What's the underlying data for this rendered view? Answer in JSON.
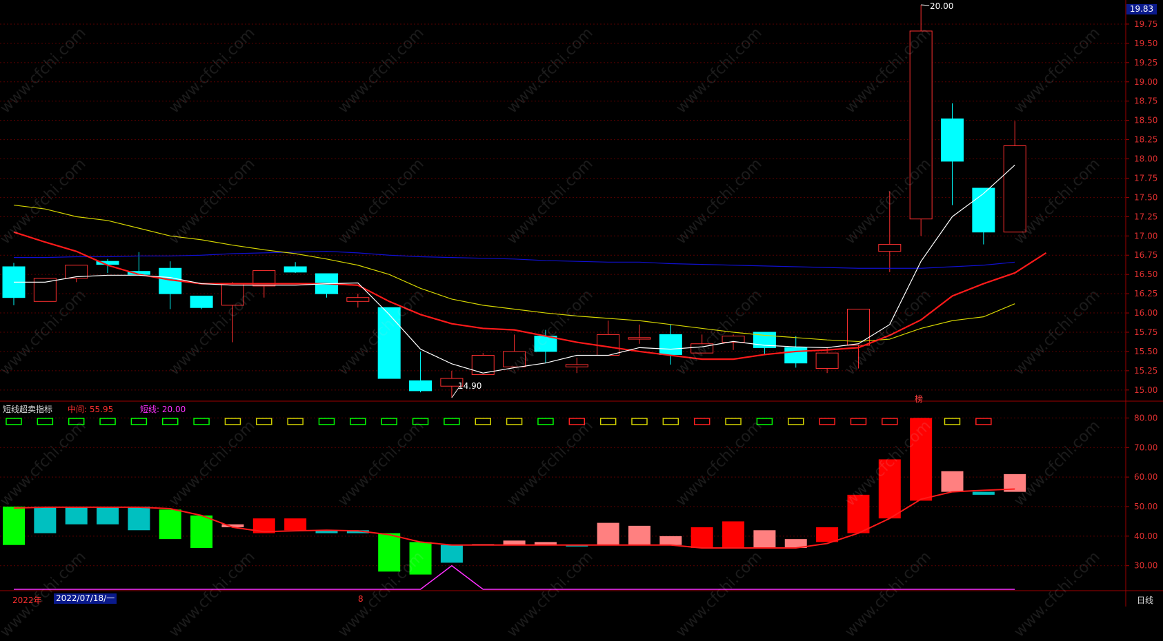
{
  "indicator": {
    "title": "短线超卖指标",
    "mid_label": "中间: 55.95",
    "short_label": "短线: 20.00"
  },
  "price_badge": "19.83",
  "annotations": {
    "high": "20.00",
    "low": "14.90",
    "flag": "榜"
  },
  "footer": {
    "year": "2022年",
    "date": "2022/07/18/一",
    "month": "8",
    "period": "日线"
  },
  "watermark": "www.cfchi.com",
  "colors": {
    "up": "#ff3030",
    "down": "#00ffff",
    "ma5": "#ffffff",
    "ma10": "#ff1a1a",
    "ma20": "#d4d400",
    "ma60": "#1010d0",
    "grid": "#5a0000"
  },
  "chart_data": [
    {
      "type": "candlestick",
      "y_ticks": [
        15.0,
        15.25,
        15.5,
        15.75,
        16.0,
        16.25,
        16.5,
        16.75,
        17.0,
        17.25,
        17.5,
        17.75,
        18.0,
        18.25,
        18.5,
        18.75,
        19.0,
        19.25,
        19.5,
        19.75
      ],
      "ylim": [
        14.9,
        20.0
      ],
      "candles": [
        {
          "o": 16.6,
          "h": 16.65,
          "l": 16.1,
          "c": 16.2
        },
        {
          "o": 16.15,
          "h": 16.45,
          "l": 16.15,
          "c": 16.45
        },
        {
          "o": 16.45,
          "h": 16.62,
          "l": 16.4,
          "c": 16.62
        },
        {
          "o": 16.67,
          "h": 16.7,
          "l": 16.52,
          "c": 16.63
        },
        {
          "o": 16.54,
          "h": 16.79,
          "l": 16.5,
          "c": 16.5
        },
        {
          "o": 16.58,
          "h": 16.67,
          "l": 16.05,
          "c": 16.25
        },
        {
          "o": 16.22,
          "h": 16.22,
          "l": 16.05,
          "c": 16.07
        },
        {
          "o": 16.1,
          "h": 16.4,
          "l": 15.62,
          "c": 16.38
        },
        {
          "o": 16.35,
          "h": 16.55,
          "l": 16.2,
          "c": 16.55
        },
        {
          "o": 16.6,
          "h": 16.66,
          "l": 16.52,
          "c": 16.53
        },
        {
          "o": 16.51,
          "h": 16.51,
          "l": 16.2,
          "c": 16.25
        },
        {
          "o": 16.15,
          "h": 16.25,
          "l": 16.07,
          "c": 16.2
        },
        {
          "o": 16.07,
          "h": 16.07,
          "l": 15.15,
          "c": 15.15
        },
        {
          "o": 15.12,
          "h": 15.5,
          "l": 14.97,
          "c": 14.99
        },
        {
          "o": 15.05,
          "h": 15.25,
          "l": 14.9,
          "c": 15.15
        },
        {
          "o": 15.2,
          "h": 15.48,
          "l": 15.2,
          "c": 15.45
        },
        {
          "o": 15.3,
          "h": 15.72,
          "l": 15.3,
          "c": 15.5
        },
        {
          "o": 15.7,
          "h": 15.78,
          "l": 15.35,
          "c": 15.5
        },
        {
          "o": 15.3,
          "h": 15.42,
          "l": 15.22,
          "c": 15.33
        },
        {
          "o": 15.45,
          "h": 15.9,
          "l": 15.45,
          "c": 15.72
        },
        {
          "o": 15.66,
          "h": 15.85,
          "l": 15.6,
          "c": 15.68
        },
        {
          "o": 15.72,
          "h": 15.85,
          "l": 15.33,
          "c": 15.46
        },
        {
          "o": 15.48,
          "h": 15.72,
          "l": 15.48,
          "c": 15.6
        },
        {
          "o": 15.62,
          "h": 15.72,
          "l": 15.52,
          "c": 15.7
        },
        {
          "o": 15.75,
          "h": 15.75,
          "l": 15.45,
          "c": 15.55
        },
        {
          "o": 15.55,
          "h": 15.7,
          "l": 15.29,
          "c": 15.35
        },
        {
          "o": 15.28,
          "h": 15.55,
          "l": 15.22,
          "c": 15.48
        },
        {
          "o": 15.58,
          "h": 16.05,
          "l": 15.28,
          "c": 16.05
        },
        {
          "o": 16.8,
          "h": 17.58,
          "l": 16.53,
          "c": 16.89
        },
        {
          "o": 17.22,
          "h": 20.0,
          "l": 17.0,
          "c": 19.66
        },
        {
          "o": 18.52,
          "h": 18.72,
          "l": 17.4,
          "c": 17.97
        },
        {
          "o": 17.62,
          "h": 17.62,
          "l": 16.89,
          "c": 17.05
        },
        {
          "o": 17.05,
          "h": 18.49,
          "l": 17.05,
          "c": 18.17
        }
      ],
      "ma5": [
        16.4,
        16.4,
        16.47,
        16.49,
        16.49,
        16.46,
        16.38,
        16.36,
        16.36,
        16.36,
        16.38,
        16.39,
        15.98,
        15.53,
        15.34,
        15.22,
        15.29,
        15.35,
        15.45,
        15.45,
        15.55,
        15.53,
        15.56,
        15.63,
        15.58,
        15.56,
        15.55,
        15.6,
        15.85,
        16.67,
        17.25,
        17.55,
        17.92
      ],
      "ma10": [
        17.05,
        16.92,
        16.8,
        16.62,
        16.5,
        16.43,
        16.38,
        16.38,
        16.38,
        16.38,
        16.38,
        16.36,
        16.15,
        15.98,
        15.86,
        15.8,
        15.78,
        15.7,
        15.62,
        15.56,
        15.5,
        15.45,
        15.4,
        15.4,
        15.46,
        15.5,
        15.52,
        15.55,
        15.71,
        15.91,
        16.22,
        16.38,
        16.52,
        16.78
      ],
      "ma20": [
        17.4,
        17.35,
        17.25,
        17.2,
        17.1,
        17.0,
        16.95,
        16.88,
        16.82,
        16.77,
        16.7,
        16.62,
        16.5,
        16.32,
        16.18,
        16.1,
        16.05,
        16.0,
        15.96,
        15.93,
        15.9,
        15.85,
        15.8,
        15.75,
        15.71,
        15.68,
        15.65,
        15.63,
        15.66,
        15.8,
        15.9,
        15.95,
        16.12
      ],
      "ma60": [
        16.72,
        16.72,
        16.73,
        16.73,
        16.74,
        16.74,
        16.75,
        16.77,
        16.78,
        16.79,
        16.8,
        16.78,
        16.75,
        16.73,
        16.72,
        16.71,
        16.7,
        16.68,
        16.67,
        16.66,
        16.66,
        16.64,
        16.63,
        16.62,
        16.61,
        16.6,
        16.59,
        16.58,
        16.58,
        16.58,
        16.6,
        16.62,
        16.66
      ]
    },
    {
      "type": "bar",
      "name": "短线超卖指标",
      "y_ticks": [
        30,
        40,
        50,
        60,
        70,
        80
      ],
      "ylim": [
        22,
        85
      ],
      "bars": [
        {
          "from": 50,
          "to": 37,
          "color": "#00ff00"
        },
        {
          "from": 50,
          "to": 41,
          "color": "#00c0c0"
        },
        {
          "from": 50,
          "to": 44,
          "color": "#00c0c0"
        },
        {
          "from": 50,
          "to": 44,
          "color": "#00c0c0"
        },
        {
          "from": 50,
          "to": 42,
          "color": "#00c0c0"
        },
        {
          "from": 49,
          "to": 39,
          "color": "#00ff00"
        },
        {
          "from": 47,
          "to": 36,
          "color": "#00ff00"
        },
        {
          "from": 43,
          "to": 44,
          "color": "#ff8080"
        },
        {
          "from": 41,
          "to": 46,
          "color": "#ff0000"
        },
        {
          "from": 42,
          "to": 46,
          "color": "#ff0000"
        },
        {
          "from": 42,
          "to": 41,
          "color": "#00c0c0"
        },
        {
          "from": 42,
          "to": 41,
          "color": "#00c0c0"
        },
        {
          "from": 41,
          "to": 28,
          "color": "#00ff00"
        },
        {
          "from": 38,
          "to": 27,
          "color": "#00ff00"
        },
        {
          "from": 37,
          "to": 31,
          "color": "#00c0c0"
        },
        {
          "from": 37,
          "to": 37.3,
          "color": "#ff8080"
        },
        {
          "from": 37,
          "to": 38.5,
          "color": "#ff8080"
        },
        {
          "from": 37,
          "to": 38,
          "color": "#ff8080"
        },
        {
          "from": 37,
          "to": 36.5,
          "color": "#00c0c0"
        },
        {
          "from": 37,
          "to": 44.5,
          "color": "#ff8080"
        },
        {
          "from": 37,
          "to": 43.5,
          "color": "#ff8080"
        },
        {
          "from": 37,
          "to": 40,
          "color": "#ff8080"
        },
        {
          "from": 36,
          "to": 43,
          "color": "#ff0000"
        },
        {
          "from": 36,
          "to": 45,
          "color": "#ff0000"
        },
        {
          "from": 36,
          "to": 42,
          "color": "#ff8080"
        },
        {
          "from": 36,
          "to": 39,
          "color": "#ff8080"
        },
        {
          "from": 38,
          "to": 43,
          "color": "#ff0000"
        },
        {
          "from": 41,
          "to": 54,
          "color": "#ff0000"
        },
        {
          "from": 46,
          "to": 66,
          "color": "#ff0000"
        },
        {
          "from": 52,
          "to": 80,
          "color": "#ff0000"
        },
        {
          "from": 55,
          "to": 62,
          "color": "#ff8080"
        },
        {
          "from": 55,
          "to": 54,
          "color": "#00c0c0"
        },
        {
          "from": 55,
          "to": 61,
          "color": "#ff8080"
        }
      ],
      "mid_line": [
        49.5,
        49.8,
        49.8,
        49.8,
        49.8,
        49.3,
        47.0,
        43.0,
        41.5,
        41.8,
        42.0,
        41.8,
        40.5,
        38.0,
        37.0,
        37.0,
        37.0,
        37.0,
        37.0,
        37.0,
        37.0,
        37.0,
        36.0,
        36.0,
        36.0,
        36.0,
        37.5,
        41.0,
        46.0,
        52.5,
        55.0,
        55.5,
        55.95
      ],
      "short_line": [
        20,
        20,
        20,
        20,
        20,
        20,
        20,
        20,
        20,
        20,
        20,
        20,
        20,
        20,
        30,
        20,
        20,
        20,
        20,
        20,
        20,
        20,
        20,
        20,
        20,
        20,
        20,
        20,
        20,
        20,
        20,
        20,
        20
      ],
      "signal_boxes": [
        "#00ff00",
        "#00ff00",
        "#00ff00",
        "#00ff00",
        "#00ff00",
        "#00ff00",
        "#00ff00",
        "#d4d400",
        "#d4d400",
        "#d4d400",
        "#00ff00",
        "#00ff00",
        "#00ff00",
        "#00ff00",
        "#00ff00",
        "#d4d400",
        "#d4d400",
        "#00ff00",
        "#ff2020",
        "#d4d400",
        "#d4d400",
        "#d4d400",
        "#ff2020",
        "#d4d400",
        "#00ff00",
        "#d4d400",
        "#ff2020",
        "#ff2020",
        "#ff2020",
        "#ff2020",
        "#d4d400",
        "#ff2020"
      ]
    }
  ]
}
